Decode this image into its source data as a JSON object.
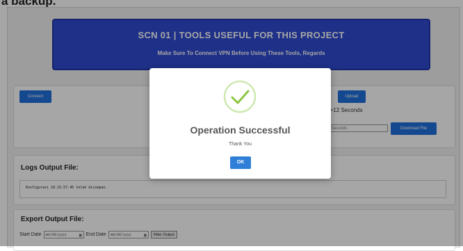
{
  "caption": "a backup.",
  "banner": {
    "title": "SCN 01 | TOOLS USEFUL FOR THIS PROJECT",
    "subtitle": "Make Sure To Connect VPN Before Using These Tools, Regards"
  },
  "connection": {
    "connect_label": "Connect",
    "upload_label": "Upload",
    "seconds_text": "e >12 Seconds",
    "seconds_placeholder": "Seconds",
    "download_label": "Download File"
  },
  "logs": {
    "heading": "Logs Output File:",
    "log_line": "Konfigurasi 10.15.57.45 telah disimpan."
  },
  "export": {
    "heading": "Export Output File:",
    "start_label": "Start Date",
    "end_label": "End Date",
    "date_placeholder": "mm/dd/yyyy",
    "filter_label": "Filter Output"
  },
  "modal": {
    "title": "Operation Successful",
    "message": "Thank You",
    "ok_label": "OK"
  },
  "colors": {
    "banner": "#2f4bd1",
    "button": "#1f6fdc",
    "success": "#8cc63f"
  },
  "icons": {
    "success": "checkmark-circle-icon",
    "calendar": "calendar-icon"
  }
}
